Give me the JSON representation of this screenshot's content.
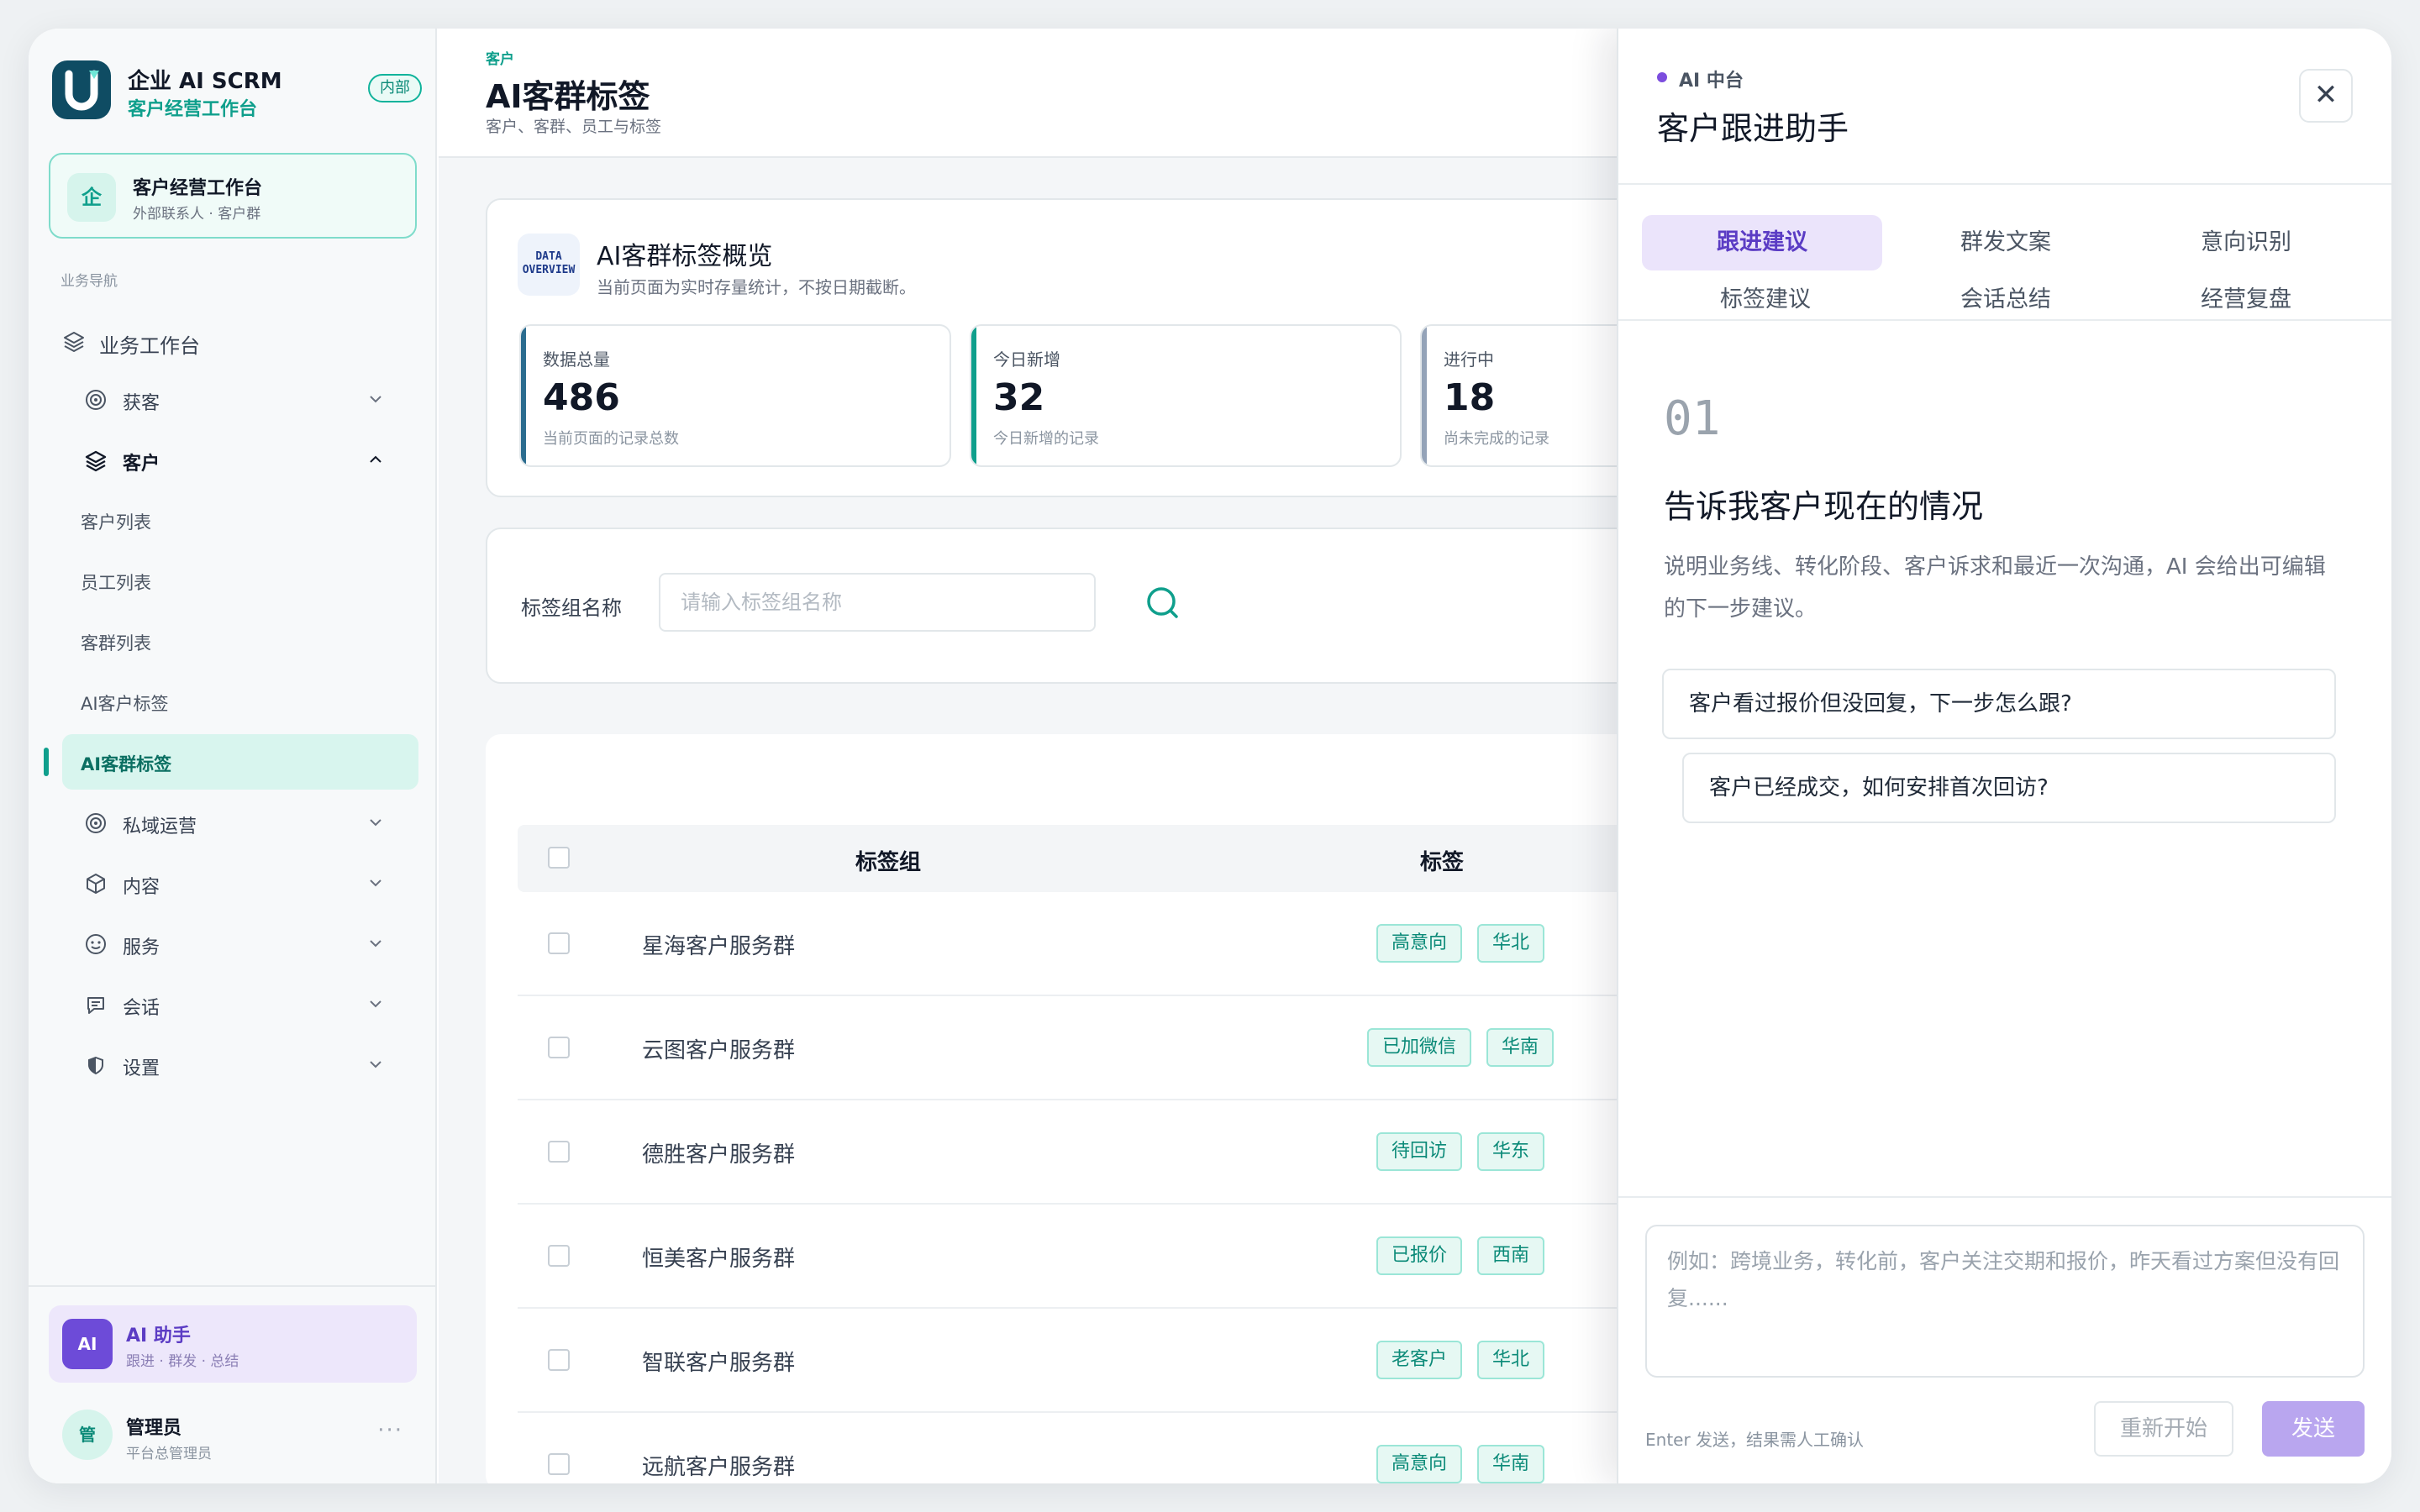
{
  "brand": {
    "title": "企业 AI SCRM",
    "subtitle": "客户经营工作台",
    "badge": "内部",
    "accent": "#0f9f8c"
  },
  "workspace": {
    "icon_char": "企",
    "title": "客户经营工作台",
    "subtitle": "外部联系人 · 客户群"
  },
  "nav": {
    "caption": "业务导航",
    "items": [
      {
        "label": "业务工作台",
        "icon": "layers-icon",
        "level": "top"
      },
      {
        "label": "获客",
        "icon": "target-icon",
        "level": "group",
        "expanded": false
      },
      {
        "label": "客户",
        "icon": "layers-icon",
        "level": "group",
        "expanded": true
      },
      {
        "label": "客户列表",
        "level": "sub"
      },
      {
        "label": "员工列表",
        "level": "sub"
      },
      {
        "label": "客群列表",
        "level": "sub"
      },
      {
        "label": "AI客户标签",
        "level": "sub"
      },
      {
        "label": "AI客群标签",
        "level": "sub",
        "active": true
      },
      {
        "label": "私域运营",
        "icon": "target-icon",
        "level": "group",
        "expanded": false
      },
      {
        "label": "内容",
        "icon": "cube-icon",
        "level": "group",
        "expanded": false
      },
      {
        "label": "服务",
        "icon": "smile-icon",
        "level": "group",
        "expanded": false
      },
      {
        "label": "会话",
        "icon": "chat-icon",
        "level": "group",
        "expanded": false
      },
      {
        "label": "设置",
        "icon": "shield-icon",
        "level": "group",
        "expanded": false
      }
    ]
  },
  "assistant_card": {
    "avatar": "AI",
    "title": "AI 助手",
    "subtitle": "跟进 · 群发 · 总结"
  },
  "user": {
    "avatar": "管",
    "name": "管理员",
    "role": "平台总管理员",
    "more": "···"
  },
  "header": {
    "breadcrumb": "客户",
    "title": "AI客群标签",
    "subtitle": "客户、客群、员工与标签"
  },
  "overview": {
    "icon_text_1": "DATA",
    "icon_text_2": "OVERVIEW",
    "title": "AI客群标签概览",
    "subtitle": "当前页面为实时存量统计，不按日期截断。",
    "stats": [
      {
        "label": "数据总量",
        "value": "486",
        "hint": "当前页面的记录总数",
        "color": "#2b6c8f"
      },
      {
        "label": "今日新增",
        "value": "32",
        "hint": "今日新增的记录",
        "color": "#0f9f8c"
      },
      {
        "label": "进行中",
        "value": "18",
        "hint": "尚未完成的记录",
        "color": "#94a3b8"
      }
    ]
  },
  "filter": {
    "label": "标签组名称",
    "placeholder": "请输入标签组名称",
    "value": ""
  },
  "table": {
    "columns": [
      "标签组",
      "标签"
    ],
    "rows": [
      {
        "name": "星海客户服务群",
        "tags": [
          "高意向",
          "华北"
        ]
      },
      {
        "name": "云图客户服务群",
        "tags": [
          "已加微信",
          "华南"
        ]
      },
      {
        "name": "德胜客户服务群",
        "tags": [
          "待回访",
          "华东"
        ]
      },
      {
        "name": "恒美客户服务群",
        "tags": [
          "已报价",
          "西南"
        ]
      },
      {
        "name": "智联客户服务群",
        "tags": [
          "老客户",
          "华北"
        ]
      },
      {
        "name": "远航客户服务群",
        "tags": [
          "高意向",
          "华南"
        ]
      }
    ]
  },
  "drawer": {
    "kicker": "AI 中台",
    "title": "客户跟进助手",
    "close": "✕",
    "accent": "#6d4bd8",
    "tabs": [
      "跟进建议",
      "群发文案",
      "意向识别",
      "标签建议",
      "会话总结",
      "经营复盘"
    ],
    "active_tab": 0,
    "step": {
      "number": "01",
      "title": "告诉我客户现在的情况",
      "description": "说明业务线、转化阶段、客户诉求和最近一次沟通，AI 会给出可编辑的下一步建议。"
    },
    "suggestions": [
      "客户看过报价但没回复，下一步怎么跟?",
      "客户已经成交，如何安排首次回访?"
    ],
    "input": {
      "placeholder": "例如：跨境业务，转化前，客户关注交期和报价，昨天看过方案但没有回复......",
      "value": ""
    },
    "hint": "Enter 发送，结果需人工确认",
    "reset_label": "重新开始",
    "send_label": "发送"
  }
}
